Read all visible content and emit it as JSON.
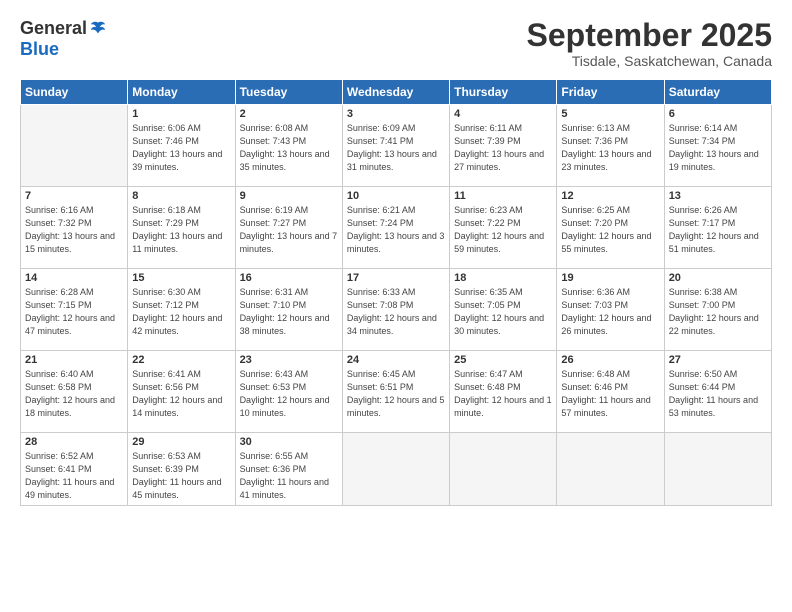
{
  "logo": {
    "general": "General",
    "blue": "Blue"
  },
  "title": "September 2025",
  "location": "Tisdale, Saskatchewan, Canada",
  "days_of_week": [
    "Sunday",
    "Monday",
    "Tuesday",
    "Wednesday",
    "Thursday",
    "Friday",
    "Saturday"
  ],
  "weeks": [
    [
      {
        "day": "",
        "empty": true
      },
      {
        "day": "1",
        "sunrise": "6:06 AM",
        "sunset": "7:46 PM",
        "daylight": "13 hours and 39 minutes."
      },
      {
        "day": "2",
        "sunrise": "6:08 AM",
        "sunset": "7:43 PM",
        "daylight": "13 hours and 35 minutes."
      },
      {
        "day": "3",
        "sunrise": "6:09 AM",
        "sunset": "7:41 PM",
        "daylight": "13 hours and 31 minutes."
      },
      {
        "day": "4",
        "sunrise": "6:11 AM",
        "sunset": "7:39 PM",
        "daylight": "13 hours and 27 minutes."
      },
      {
        "day": "5",
        "sunrise": "6:13 AM",
        "sunset": "7:36 PM",
        "daylight": "13 hours and 23 minutes."
      },
      {
        "day": "6",
        "sunrise": "6:14 AM",
        "sunset": "7:34 PM",
        "daylight": "13 hours and 19 minutes."
      }
    ],
    [
      {
        "day": "7",
        "sunrise": "6:16 AM",
        "sunset": "7:32 PM",
        "daylight": "13 hours and 15 minutes."
      },
      {
        "day": "8",
        "sunrise": "6:18 AM",
        "sunset": "7:29 PM",
        "daylight": "13 hours and 11 minutes."
      },
      {
        "day": "9",
        "sunrise": "6:19 AM",
        "sunset": "7:27 PM",
        "daylight": "13 hours and 7 minutes."
      },
      {
        "day": "10",
        "sunrise": "6:21 AM",
        "sunset": "7:24 PM",
        "daylight": "13 hours and 3 minutes."
      },
      {
        "day": "11",
        "sunrise": "6:23 AM",
        "sunset": "7:22 PM",
        "daylight": "12 hours and 59 minutes."
      },
      {
        "day": "12",
        "sunrise": "6:25 AM",
        "sunset": "7:20 PM",
        "daylight": "12 hours and 55 minutes."
      },
      {
        "day": "13",
        "sunrise": "6:26 AM",
        "sunset": "7:17 PM",
        "daylight": "12 hours and 51 minutes."
      }
    ],
    [
      {
        "day": "14",
        "sunrise": "6:28 AM",
        "sunset": "7:15 PM",
        "daylight": "12 hours and 47 minutes."
      },
      {
        "day": "15",
        "sunrise": "6:30 AM",
        "sunset": "7:12 PM",
        "daylight": "12 hours and 42 minutes."
      },
      {
        "day": "16",
        "sunrise": "6:31 AM",
        "sunset": "7:10 PM",
        "daylight": "12 hours and 38 minutes."
      },
      {
        "day": "17",
        "sunrise": "6:33 AM",
        "sunset": "7:08 PM",
        "daylight": "12 hours and 34 minutes."
      },
      {
        "day": "18",
        "sunrise": "6:35 AM",
        "sunset": "7:05 PM",
        "daylight": "12 hours and 30 minutes."
      },
      {
        "day": "19",
        "sunrise": "6:36 AM",
        "sunset": "7:03 PM",
        "daylight": "12 hours and 26 minutes."
      },
      {
        "day": "20",
        "sunrise": "6:38 AM",
        "sunset": "7:00 PM",
        "daylight": "12 hours and 22 minutes."
      }
    ],
    [
      {
        "day": "21",
        "sunrise": "6:40 AM",
        "sunset": "6:58 PM",
        "daylight": "12 hours and 18 minutes."
      },
      {
        "day": "22",
        "sunrise": "6:41 AM",
        "sunset": "6:56 PM",
        "daylight": "12 hours and 14 minutes."
      },
      {
        "day": "23",
        "sunrise": "6:43 AM",
        "sunset": "6:53 PM",
        "daylight": "12 hours and 10 minutes."
      },
      {
        "day": "24",
        "sunrise": "6:45 AM",
        "sunset": "6:51 PM",
        "daylight": "12 hours and 5 minutes."
      },
      {
        "day": "25",
        "sunrise": "6:47 AM",
        "sunset": "6:48 PM",
        "daylight": "12 hours and 1 minute."
      },
      {
        "day": "26",
        "sunrise": "6:48 AM",
        "sunset": "6:46 PM",
        "daylight": "11 hours and 57 minutes."
      },
      {
        "day": "27",
        "sunrise": "6:50 AM",
        "sunset": "6:44 PM",
        "daylight": "11 hours and 53 minutes."
      }
    ],
    [
      {
        "day": "28",
        "sunrise": "6:52 AM",
        "sunset": "6:41 PM",
        "daylight": "11 hours and 49 minutes."
      },
      {
        "day": "29",
        "sunrise": "6:53 AM",
        "sunset": "6:39 PM",
        "daylight": "11 hours and 45 minutes."
      },
      {
        "day": "30",
        "sunrise": "6:55 AM",
        "sunset": "6:36 PM",
        "daylight": "11 hours and 41 minutes."
      },
      {
        "day": "",
        "empty": true
      },
      {
        "day": "",
        "empty": true
      },
      {
        "day": "",
        "empty": true
      },
      {
        "day": "",
        "empty": true
      }
    ]
  ]
}
